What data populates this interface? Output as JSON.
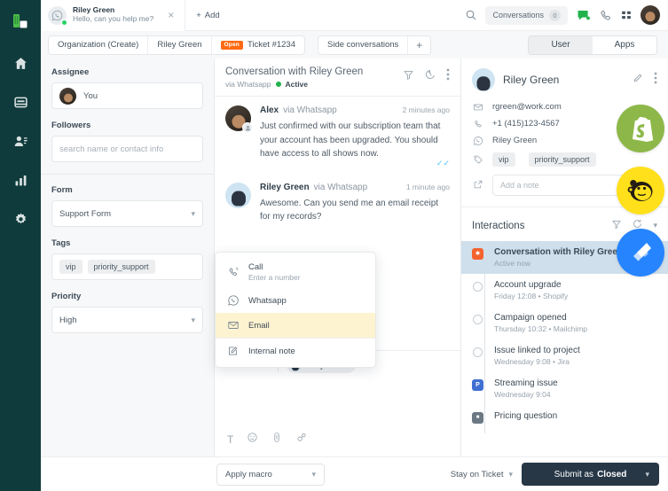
{
  "rail": {
    "logo": "brand-logo",
    "items": [
      {
        "name": "home",
        "icon": "home-icon"
      },
      {
        "name": "conversations",
        "icon": "inbox-icon"
      },
      {
        "name": "contacts",
        "icon": "contacts-icon"
      },
      {
        "name": "reports",
        "icon": "bar-chart-icon"
      },
      {
        "name": "settings",
        "icon": "gear-icon"
      }
    ]
  },
  "topbar": {
    "tab": {
      "name": "Riley Green",
      "preview": "Hello, can you help me?",
      "channel_icon": "whatsapp-icon",
      "close_label": "×"
    },
    "add_label": "Add",
    "search_icon": "search-icon",
    "conversations_label": "Conversations",
    "conversations_count": "0",
    "chat_icon": "chat-bubble-icon",
    "phone_icon": "phone-icon",
    "grid_icon": "apps-grid-icon",
    "avatar": "user-avatar"
  },
  "breadcrumbs": {
    "organization": "Organization (Create)",
    "contact": "Riley Green",
    "ticket_badge": "Open",
    "ticket": "Ticket #1234",
    "side_conversations": "Side conversations",
    "plus": "+",
    "tabs": [
      {
        "label": "User",
        "active": true
      },
      {
        "label": "Apps",
        "active": false
      }
    ]
  },
  "properties": {
    "assignee_label": "Assignee",
    "assignee_value": "You",
    "followers_label": "Followers",
    "followers_placeholder": "search name or contact info",
    "form_label": "Form",
    "form_value": "Support Form",
    "tags_label": "Tags",
    "tags": [
      "vip",
      "priority_support"
    ],
    "priority_label": "Priority",
    "priority_value": "High"
  },
  "conversation": {
    "title": "Conversation with Riley Green",
    "via": "via Whatsapp",
    "status": "Active",
    "filter_icon": "filter-icon",
    "history_icon": "history-icon",
    "more_icon": "more-vertical-icon",
    "messages": [
      {
        "author": "Alex",
        "via": "via Whatsapp",
        "time": "2 minutes ago",
        "text": "Just confirmed with our subscription team that your account has been upgraded. You should have access to all shows now.",
        "read": true
      },
      {
        "author": "Riley Green",
        "via": "via Whatsapp",
        "time": "1 minute ago",
        "text": "Awesome. Can you send me an email receipt for my records?",
        "read": false
      }
    ]
  },
  "channel_dropdown": {
    "items": [
      {
        "label": "Call",
        "sub": "Enter a number",
        "icon": "call-icon",
        "highlighted": false
      },
      {
        "label": "Whatsapp",
        "sub": "",
        "icon": "whatsapp-icon",
        "highlighted": false
      },
      {
        "label": "Email",
        "sub": "",
        "icon": "email-icon",
        "highlighted": true
      },
      {
        "label": "Internal note",
        "sub": "",
        "icon": "note-icon",
        "highlighted": false
      }
    ]
  },
  "composer": {
    "channel": "Email",
    "recipient": "Riley Green",
    "tools": [
      {
        "name": "text-format-icon",
        "glyph": "T"
      },
      {
        "name": "emoji-icon",
        "glyph": ""
      },
      {
        "name": "attachment-icon",
        "glyph": ""
      },
      {
        "name": "link-icon",
        "glyph": ""
      }
    ]
  },
  "contact": {
    "name": "Riley Green",
    "edit_icon": "pencil-icon",
    "more_icon": "more-vertical-icon",
    "email": "rgreen@work.com",
    "phone": "+1 (415)123-4567",
    "whatsapp": "Riley Green",
    "tags": [
      "vip",
      "priority_support"
    ],
    "note_placeholder": "Add a note"
  },
  "interactions": {
    "title": "Interactions",
    "filter_icon": "filter-icon",
    "refresh_icon": "refresh-icon",
    "collapse_icon": "chevron-down-icon",
    "items": [
      {
        "title": "Conversation with Riley Green",
        "sub": "Active now",
        "marker": "square",
        "marker_color": "#f4622f",
        "marker_glyph": "✶",
        "active": true
      },
      {
        "title": "Account upgrade",
        "sub": "Friday 12:08 • Shopify",
        "marker": "circle",
        "marker_color": "",
        "marker_glyph": "",
        "active": false
      },
      {
        "title": "Campaign opened",
        "sub": "Thursday 10:32 • Mailchimp",
        "marker": "circle",
        "marker_color": "",
        "marker_glyph": "",
        "active": false
      },
      {
        "title": "Issue linked to project",
        "sub": "Wednesday 9:08 • Jira",
        "marker": "circle",
        "marker_color": "",
        "marker_glyph": "",
        "active": false
      },
      {
        "title": "Streaming issue",
        "sub": "Wednesday 9:04",
        "marker": "square",
        "marker_color": "#3f6fd1",
        "marker_glyph": "P",
        "active": false
      },
      {
        "title": "Pricing question",
        "sub": "",
        "marker": "square",
        "marker_color": "#6b7883",
        "marker_glyph": "■",
        "active": false
      }
    ],
    "logos": [
      {
        "name": "shopify-logo",
        "color": "#8db849"
      },
      {
        "name": "mailchimp-logo",
        "color": "#ffe01b"
      },
      {
        "name": "jira-logo",
        "color": "#2684ff"
      }
    ]
  },
  "bottombar": {
    "macro_label": "Apply macro",
    "stay_label": "Stay on Ticket",
    "submit_prefix": "Submit as",
    "submit_state": "Closed"
  },
  "colors": {
    "rail_bg": "#103b3c",
    "accent_orange": "#ff6a13",
    "submit_dark": "#273746",
    "highlight_yellow": "#fdf3d0",
    "active_blue": "#cfdfeb",
    "whatsapp_green": "#25d366"
  }
}
